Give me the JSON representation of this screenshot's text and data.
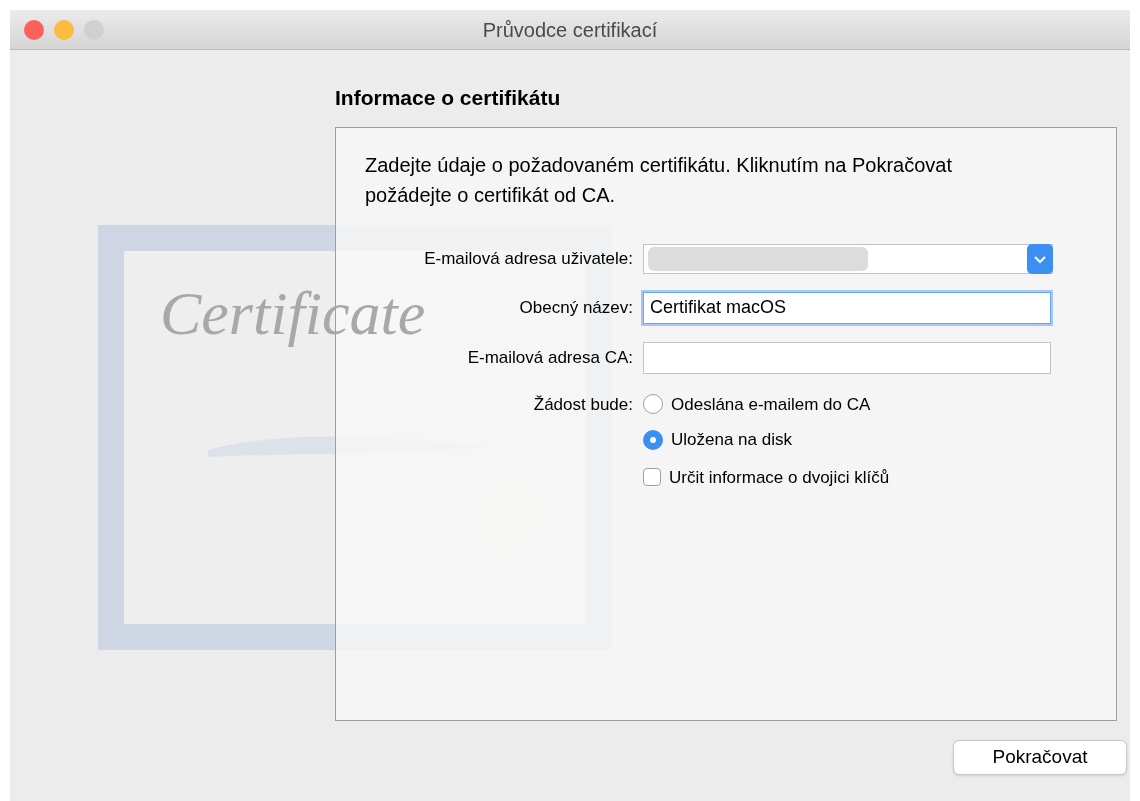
{
  "window": {
    "title": "Průvodce certifikací",
    "buttons": [
      {
        "color": "#fc605c"
      },
      {
        "color": "#fdbc40"
      },
      {
        "color": "#d0d0d0"
      }
    ]
  },
  "artwork": {
    "script": "Certificate"
  },
  "heading": "Informace o certifikátu",
  "intro": "Zadejte údaje o požadovaném certifikátu. Kliknutím na Pokračovat požádejte o certifikát od CA.",
  "fields": [
    {
      "kind": "combo",
      "label": "E-mailová adresa uživatele:",
      "redacted": true,
      "focused": false
    },
    {
      "kind": "text",
      "label": "Obecný název:",
      "value": "Certifikat macOS",
      "focused": true
    },
    {
      "kind": "text",
      "label": "E-mailová adresa CA:",
      "focused": false
    }
  ],
  "request": {
    "label": "Žádost bude:",
    "options": [
      {
        "label": "Odeslána e-mailem do CA",
        "selected": false
      },
      {
        "label": "Uložena na disk",
        "selected": true
      }
    ],
    "checkbox": {
      "label": "Určit informace o dvojici klíčů",
      "checked": false
    }
  },
  "continue_button": "Pokračovat"
}
